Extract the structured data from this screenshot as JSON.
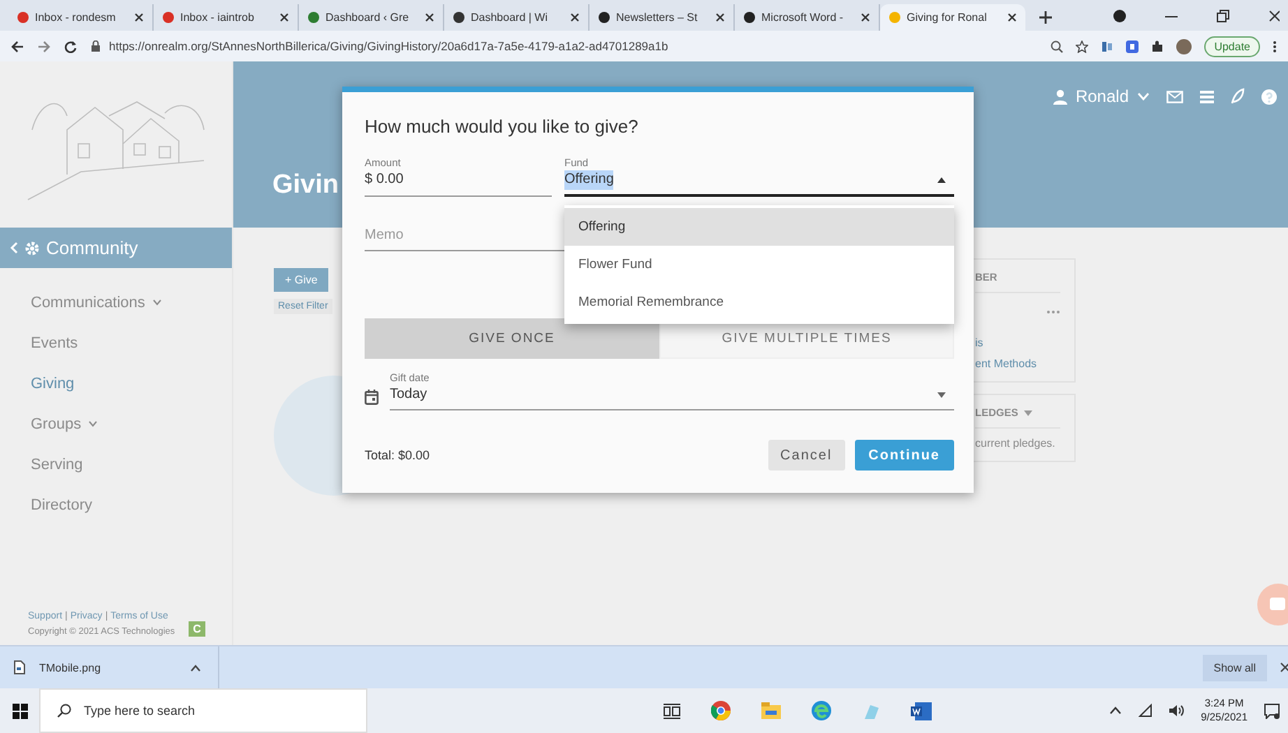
{
  "browser": {
    "tabs": [
      {
        "title": "Inbox - rondesm",
        "selected": false
      },
      {
        "title": "Inbox - iaintrob",
        "selected": false
      },
      {
        "title": "Dashboard ‹ Gre",
        "selected": false
      },
      {
        "title": "Dashboard | Wi",
        "selected": false
      },
      {
        "title": "Newsletters – St",
        "selected": false
      },
      {
        "title": "Microsoft Word -",
        "selected": false
      },
      {
        "title": "Giving for Ronal",
        "selected": true
      }
    ],
    "url": "https://onrealm.org/StAnnesNorthBillerica/Giving/GivingHistory/20a6d17a-7a5e-4179-a1a2-ad4701289a1b",
    "update_button": "Update"
  },
  "sidebar": {
    "section": "Community",
    "items": [
      {
        "label": "Communications",
        "selected": false,
        "has_submenu": true
      },
      {
        "label": "Events",
        "selected": false,
        "has_submenu": false
      },
      {
        "label": "Giving",
        "selected": true,
        "has_submenu": false
      },
      {
        "label": "Groups",
        "selected": false,
        "has_submenu": true
      },
      {
        "label": "Serving",
        "selected": false,
        "has_submenu": false
      },
      {
        "label": "Directory",
        "selected": false,
        "has_submenu": false
      }
    ],
    "footer_links": [
      {
        "kind": "link",
        "text": "Support"
      },
      {
        "kind": "separator",
        "text": "|"
      },
      {
        "kind": "link",
        "text": "Privacy"
      },
      {
        "kind": "separator",
        "text": "|"
      },
      {
        "kind": "link",
        "text": "Terms of Use"
      }
    ],
    "copyright": "Copyright © 2021 ACS Technologies",
    "badge": "C"
  },
  "header": {
    "page_title": "Givin",
    "user": "Ronald"
  },
  "content": {
    "give_button": "+ Give",
    "reset_filters": "Reset Filter"
  },
  "member_card": {
    "heading": "BER",
    "links": [
      "is",
      "ent Methods"
    ]
  },
  "pledges_card": {
    "heading": "LEDGES",
    "body": "current pledges."
  },
  "dialog": {
    "title": "How much would you like to give?",
    "amount": {
      "label": "Amount",
      "value": "$ 0.00"
    },
    "fund": {
      "label": "Fund",
      "value": "Offering",
      "expanded": true,
      "options": [
        {
          "label": "Offering",
          "selected": true
        },
        {
          "label": "Flower Fund",
          "selected": false
        },
        {
          "label": "Memorial Remembrance",
          "selected": false
        }
      ]
    },
    "memo": {
      "placeholder": "Memo"
    },
    "frequency": [
      {
        "label": "GIVE ONCE",
        "selected": true
      },
      {
        "label": "GIVE MULTIPLE TIMES",
        "selected": false
      }
    ],
    "gift_date": {
      "label": "Gift date",
      "value": "Today"
    },
    "total": "Total: $0.00",
    "buttons": [
      {
        "label": "Cancel",
        "kind": "secondary"
      },
      {
        "label": "Continue",
        "kind": "primary"
      }
    ]
  },
  "downloads": {
    "file": "TMobile.png",
    "show_all": "Show all"
  },
  "taskbar": {
    "search_placeholder": "Type here to search",
    "time": "3:24 PM",
    "date": "9/25/2021"
  }
}
